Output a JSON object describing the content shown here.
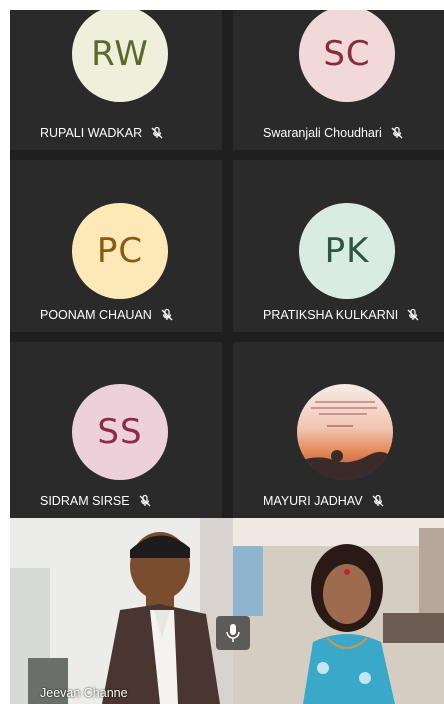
{
  "participants": [
    {
      "initials": "RW",
      "name": "RUPALI WADKAR",
      "avatar_bg": "#eef0dc",
      "initials_color": "#5a6a2b",
      "muted_icon": "mic-off-icon"
    },
    {
      "initials": "SC",
      "name": "Swaranjali Choudhari",
      "avatar_bg": "#f2d9d9",
      "initials_color": "#8a2b3b",
      "muted_icon": "mic-off-icon"
    },
    {
      "initials": "PC",
      "name": "POONAM CHAUAN",
      "avatar_bg": "#fde9b8",
      "initials_color": "#8a5a12",
      "muted_icon": "mic-off-icon"
    },
    {
      "initials": "PK",
      "name": "PRATIKSHA KULKARNI",
      "avatar_bg": "#d9ece3",
      "initials_color": "#2d5545",
      "muted_icon": "mic-off-icon"
    },
    {
      "initials": "SS",
      "name": "SIDRAM SIRSE",
      "avatar_bg": "#ecd0da",
      "initials_color": "#8a2b47",
      "muted_icon": "mic-off-icon"
    },
    {
      "initials": "",
      "name": "MAYURI JADHAV",
      "avatar_bg": "#d98a5a",
      "initials_color": "#ffffff",
      "muted_icon": "mic-off-icon",
      "avatar_photo": "sunset-quote-photo"
    }
  ],
  "video_participants": [
    {
      "name": "Jeevan Channe"
    },
    {
      "name": ""
    }
  ],
  "controls": {
    "mic_icon": "mic-icon"
  }
}
